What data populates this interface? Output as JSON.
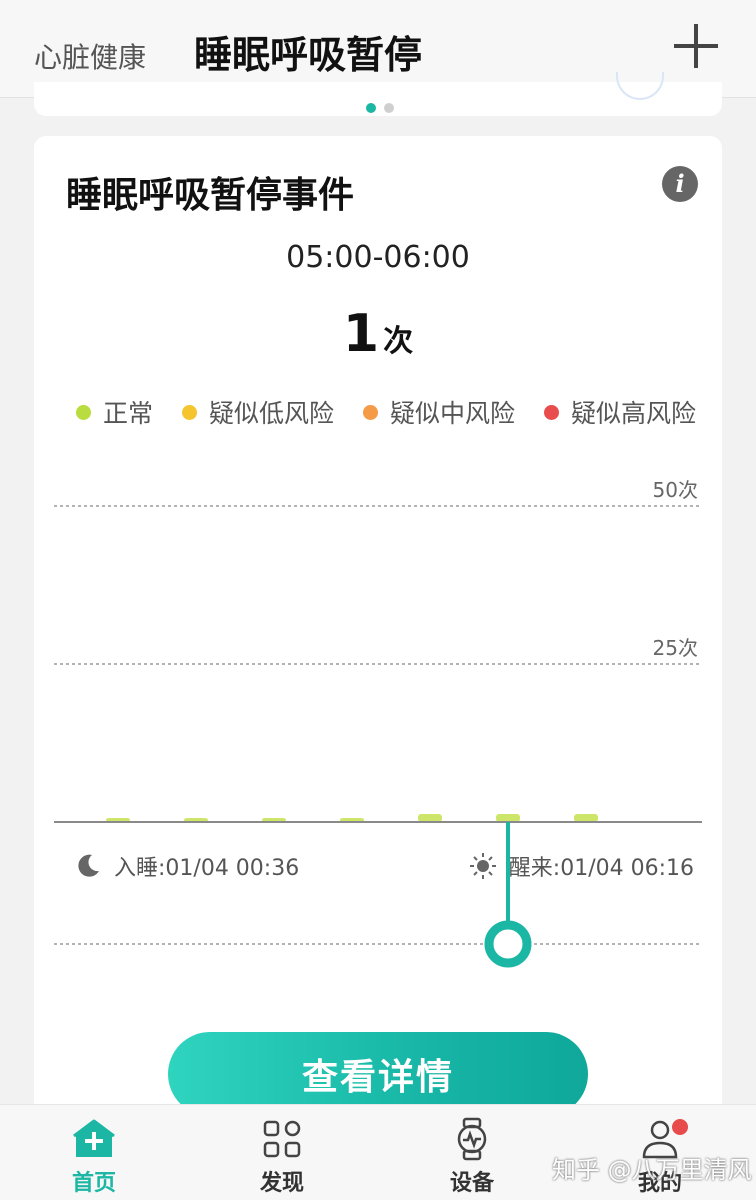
{
  "header": {
    "tab_inactive": "心脏健康",
    "tab_active": "睡眠呼吸暂停"
  },
  "card": {
    "title": "睡眠呼吸暂停事件",
    "time_range": "05:00-06:00",
    "count_value": "1",
    "count_unit": "次",
    "legend": [
      {
        "label": "正常",
        "color": "#b9dc3e"
      },
      {
        "label": "疑似低风险",
        "color": "#f5c52f"
      },
      {
        "label": "疑似中风险",
        "color": "#f59a46"
      },
      {
        "label": "疑似高风险",
        "color": "#e94c4c"
      }
    ],
    "sleep_in": "入睡:01/04 00:36",
    "wake_up": "醒来:01/04 06:16",
    "detail_button": "查看详情"
  },
  "chart_data": {
    "type": "bar",
    "title": "",
    "xlabel": "",
    "ylabel": "",
    "y_ticks": [
      "25次",
      "50次"
    ],
    "ylim": [
      0,
      50
    ],
    "values": [
      0,
      0,
      0,
      0,
      1,
      1,
      1
    ],
    "bar_color": "#cde66a",
    "selected_index": 5,
    "accent_color": "#1bb7a4"
  },
  "nav": {
    "items": [
      {
        "label": "首页",
        "icon": "home-plus-icon",
        "active": true
      },
      {
        "label": "发现",
        "icon": "discover-grid-icon",
        "active": false
      },
      {
        "label": "设备",
        "icon": "watch-icon",
        "active": false
      },
      {
        "label": "我的",
        "icon": "profile-icon",
        "active": false
      }
    ]
  },
  "watermark": "知乎 @八万里清风"
}
